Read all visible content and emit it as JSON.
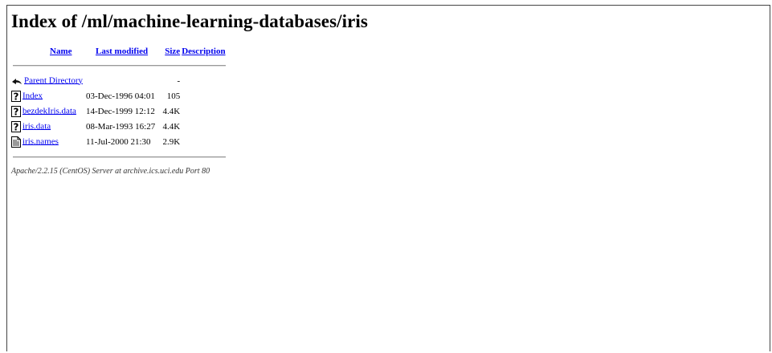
{
  "page": {
    "title": "Index of /ml/machine-learning-databases/iris"
  },
  "columns": {
    "name": "Name",
    "last_modified": "Last modified",
    "size": "Size",
    "description": "Description"
  },
  "rows": [
    {
      "icon": "back-icon",
      "name": "Parent Directory",
      "modified": "",
      "size": "-",
      "description": ""
    },
    {
      "icon": "unknown-file-icon",
      "name": "Index",
      "modified": "03-Dec-1996 04:01",
      "size": "105",
      "description": ""
    },
    {
      "icon": "unknown-file-icon",
      "name": "bezdekIris.data",
      "modified": "14-Dec-1999 12:12",
      "size": "4.4K",
      "description": ""
    },
    {
      "icon": "unknown-file-icon",
      "name": "iris.data",
      "modified": "08-Mar-1993 16:27",
      "size": "4.4K",
      "description": ""
    },
    {
      "icon": "text-file-icon",
      "name": "iris.names",
      "modified": "11-Jul-2000 21:30",
      "size": "2.9K",
      "description": ""
    }
  ],
  "footer": {
    "address": "Apache/2.2.15 (CentOS) Server at archive.ics.uci.edu Port 80"
  },
  "colors": {
    "link": "#0000ee"
  }
}
